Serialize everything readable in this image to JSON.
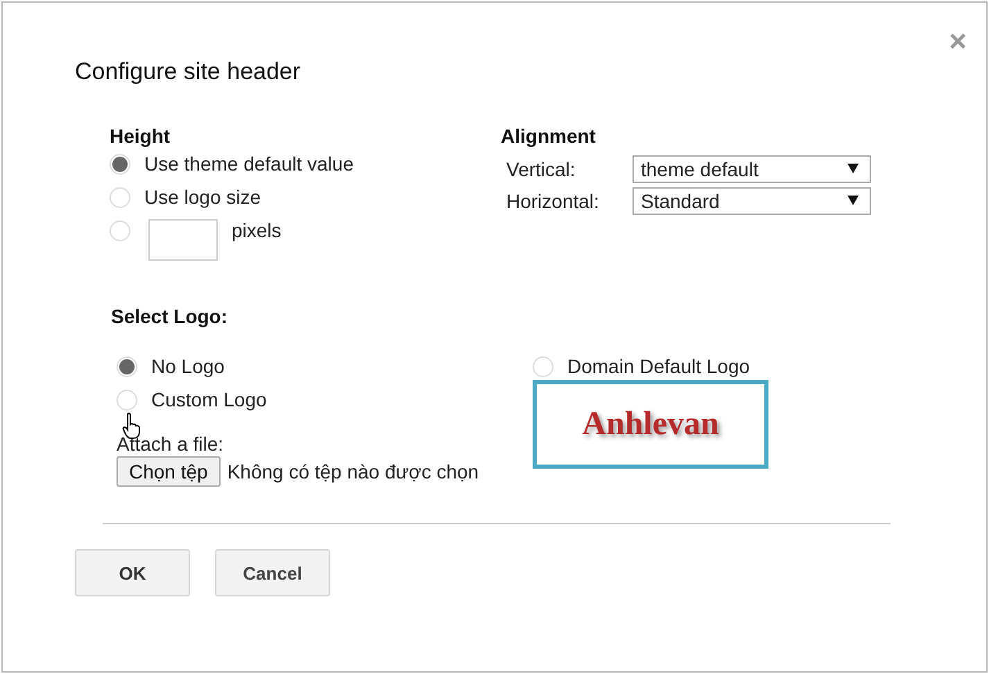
{
  "dialog": {
    "title": "Configure site header",
    "close": "×"
  },
  "height": {
    "heading": "Height",
    "options": [
      {
        "kind": "radio",
        "label": "Use theme default value",
        "selected": true
      },
      {
        "kind": "radio",
        "label": "Use logo size",
        "selected": false
      },
      {
        "kind": "pixels",
        "label": "pixels",
        "selected": false
      }
    ]
  },
  "alignment": {
    "heading": "Alignment",
    "rows": [
      {
        "label": "Vertical:",
        "value": "theme default"
      },
      {
        "label": "Horizontal:",
        "value": "Standard"
      }
    ]
  },
  "logo": {
    "heading": "Select Logo:",
    "options": [
      {
        "label": "No Logo",
        "selected": true
      },
      {
        "label": "Custom Logo",
        "selected": false
      },
      {
        "label": "Domain Default Logo",
        "selected": false
      }
    ],
    "preview_text": "Anhlevan",
    "attach_label": "Attach a file:",
    "file_button": "Chọn tệp",
    "file_status": "Không có tệp nào được chọn"
  },
  "buttons": [
    {
      "kind": "primary",
      "label": "OK"
    },
    {
      "kind": "secondary",
      "label": "Cancel"
    }
  ]
}
